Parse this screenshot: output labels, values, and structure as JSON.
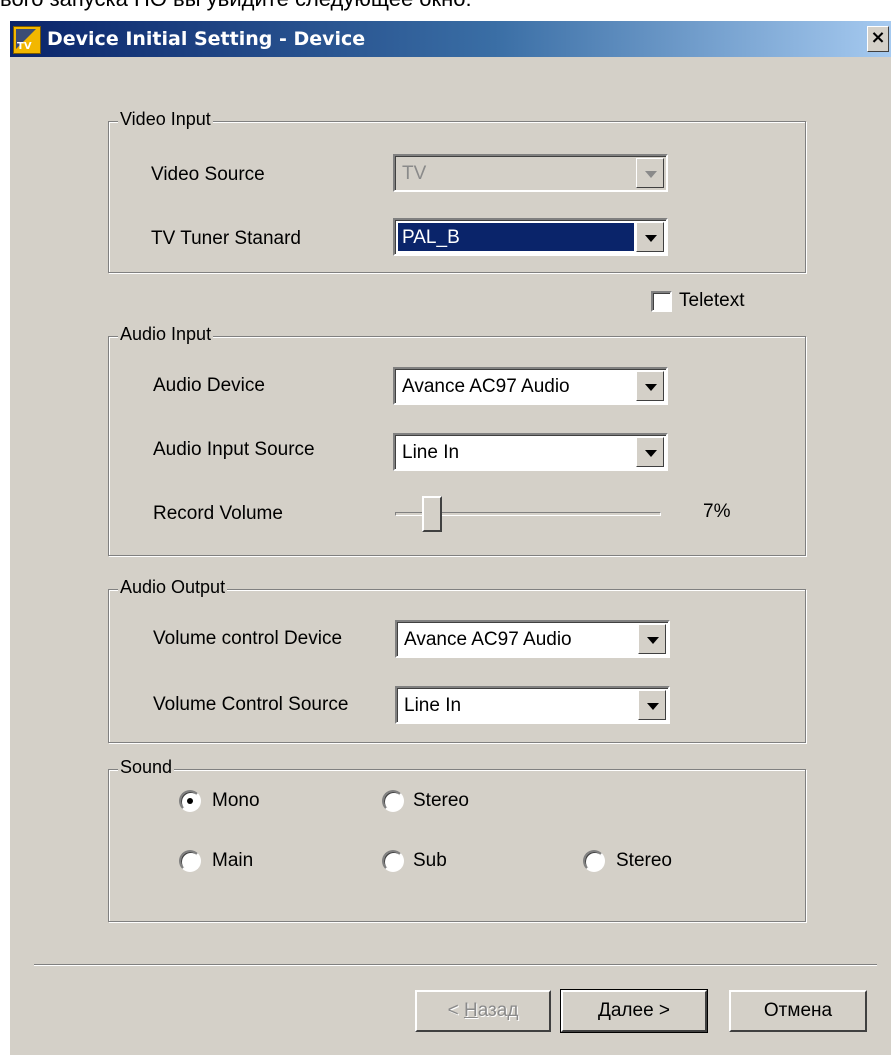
{
  "page_caption": "вого запуска ПО вы увидите следующее окно:",
  "window": {
    "icon_text": "TV",
    "title": "Device Initial Setting - Device",
    "close_label": "×"
  },
  "video_input": {
    "legend": "Video Input",
    "video_source": {
      "label": "Video Source",
      "value": "TV",
      "enabled": false
    },
    "tv_tuner_standard": {
      "label": "TV Tuner Stanard",
      "value": "PAL_B",
      "focused": true
    }
  },
  "teletext": {
    "label": "Teletext",
    "checked": false
  },
  "audio_input": {
    "legend": "Audio Input",
    "audio_device": {
      "label": "Audio Device",
      "value": "Avance AC97 Audio"
    },
    "audio_input_source": {
      "label": "Audio Input Source",
      "value": "Line In"
    },
    "record_volume": {
      "label": "Record Volume",
      "value_text": "7%",
      "level": 0.07
    }
  },
  "audio_output": {
    "legend": "Audio Output",
    "volume_control_device": {
      "label": "Volume control Device",
      "value": "Avance AC97 Audio"
    },
    "volume_control_source": {
      "label": "Volume Control Source",
      "value": "Line In"
    }
  },
  "sound": {
    "legend": "Sound",
    "row1": [
      {
        "label": "Mono",
        "checked": true
      },
      {
        "label": "Stereo",
        "checked": false
      }
    ],
    "row2": [
      {
        "label": "Main",
        "checked": false
      },
      {
        "label": "Sub",
        "checked": false
      },
      {
        "label": "Stereo",
        "checked": false
      }
    ]
  },
  "buttons": {
    "back": {
      "prefix": "< ",
      "accel": "Н",
      "rest": "азад",
      "enabled": false
    },
    "next": "Далее >",
    "cancel": "Отмена"
  },
  "colors": {
    "face": "#d4d0c8",
    "title_start": "#0a246a",
    "title_end": "#a6caf0",
    "selection": "#0a246a"
  }
}
